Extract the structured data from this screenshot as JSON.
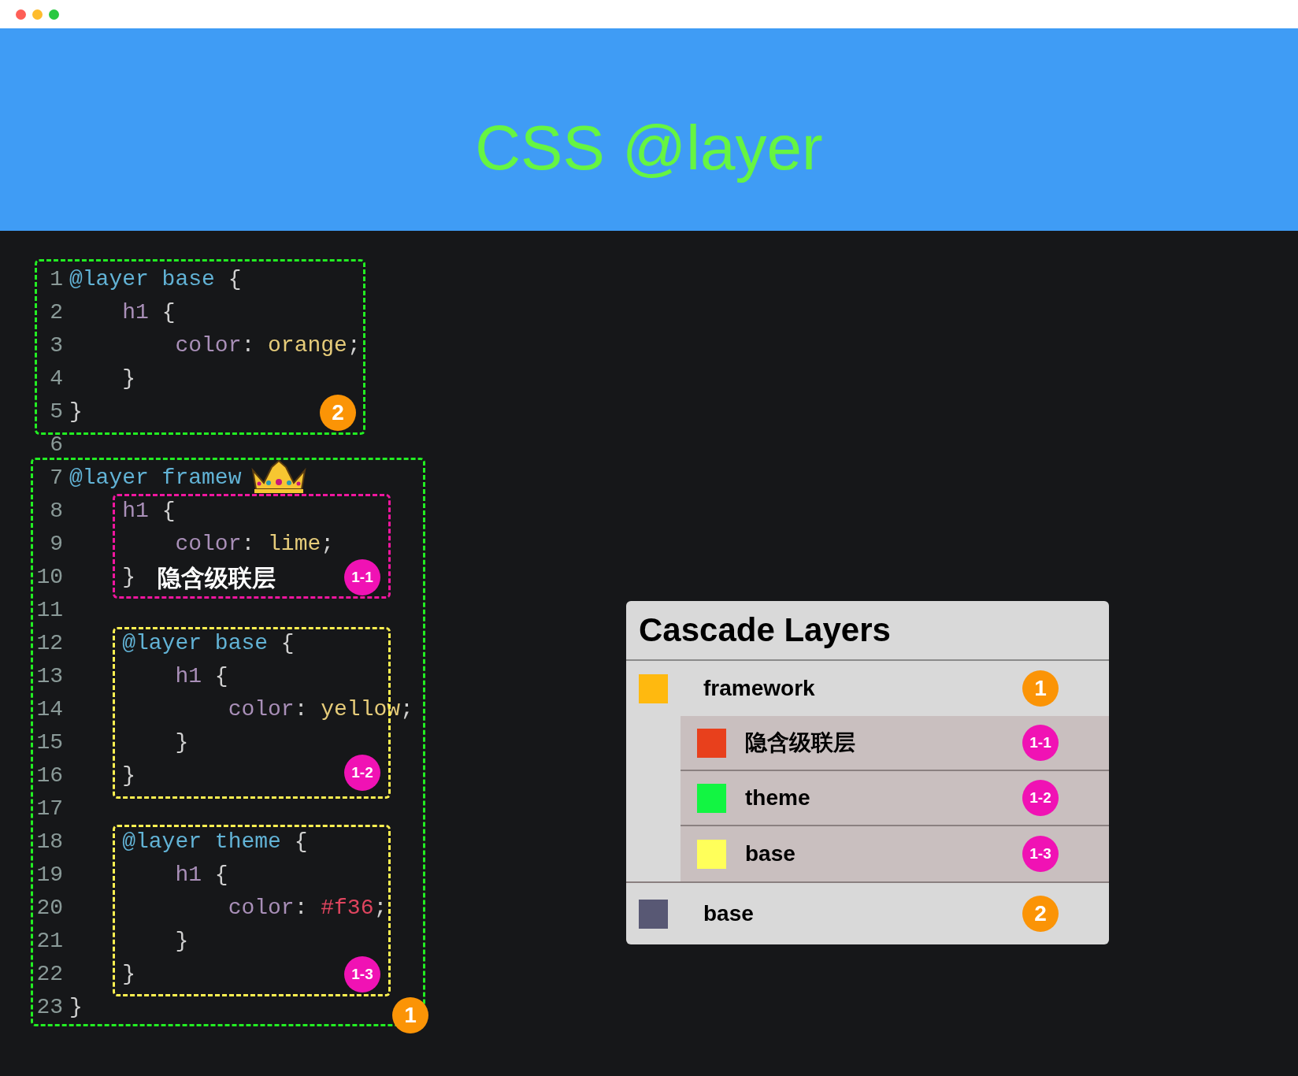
{
  "header": {
    "title": "CSS @layer"
  },
  "code": {
    "lines": [
      {
        "number": "1",
        "tokens": [
          {
            "kind": "keyword",
            "text": "@layer base"
          },
          {
            "kind": "punct",
            "text": " {"
          }
        ]
      },
      {
        "number": "2",
        "tokens": [
          {
            "kind": "selector",
            "text": "    h1"
          },
          {
            "kind": "punct",
            "text": " {"
          }
        ]
      },
      {
        "number": "3",
        "tokens": [
          {
            "kind": "property",
            "text": "        color"
          },
          {
            "kind": "punct",
            "text": ": "
          },
          {
            "kind": "value",
            "text": "orange"
          },
          {
            "kind": "punct",
            "text": ";"
          }
        ]
      },
      {
        "number": "4",
        "tokens": [
          {
            "kind": "punct",
            "text": "    }"
          }
        ]
      },
      {
        "number": "5",
        "tokens": [
          {
            "kind": "punct",
            "text": "}"
          }
        ]
      },
      {
        "number": "6"
      },
      {
        "number": "7",
        "tokens": [
          {
            "kind": "keyword",
            "text": "@layer framew"
          }
        ]
      },
      {
        "number": "8",
        "tokens": [
          {
            "kind": "selector",
            "text": "    h1"
          },
          {
            "kind": "punct",
            "text": " {"
          }
        ]
      },
      {
        "number": "9",
        "tokens": [
          {
            "kind": "property",
            "text": "        color"
          },
          {
            "kind": "punct",
            "text": ": "
          },
          {
            "kind": "value",
            "text": "lime"
          },
          {
            "kind": "punct",
            "text": ";"
          }
        ]
      },
      {
        "number": "10",
        "tokens": [
          {
            "kind": "punct",
            "text": "    }"
          }
        ],
        "note": "隐含级联层"
      },
      {
        "number": "11"
      },
      {
        "number": "12",
        "tokens": [
          {
            "kind": "keyword",
            "text": "    @layer base"
          },
          {
            "kind": "punct",
            "text": " {"
          }
        ]
      },
      {
        "number": "13",
        "tokens": [
          {
            "kind": "selector",
            "text": "        h1"
          },
          {
            "kind": "punct",
            "text": " {"
          }
        ]
      },
      {
        "number": "14",
        "tokens": [
          {
            "kind": "property",
            "text": "            color"
          },
          {
            "kind": "punct",
            "text": ": "
          },
          {
            "kind": "value",
            "text": "yellow"
          },
          {
            "kind": "punct",
            "text": ";"
          }
        ]
      },
      {
        "number": "15",
        "tokens": [
          {
            "kind": "punct",
            "text": "        }"
          }
        ]
      },
      {
        "number": "16",
        "tokens": [
          {
            "kind": "punct",
            "text": "    }"
          }
        ]
      },
      {
        "number": "17"
      },
      {
        "number": "18",
        "tokens": [
          {
            "kind": "keyword",
            "text": "    @layer theme"
          },
          {
            "kind": "punct",
            "text": " {"
          }
        ]
      },
      {
        "number": "19",
        "tokens": [
          {
            "kind": "selector",
            "text": "        h1"
          },
          {
            "kind": "punct",
            "text": " {"
          }
        ]
      },
      {
        "number": "20",
        "tokens": [
          {
            "kind": "property",
            "text": "            color"
          },
          {
            "kind": "punct",
            "text": ": "
          },
          {
            "kind": "hex",
            "text": "#f36"
          },
          {
            "kind": "punct",
            "text": ";"
          }
        ]
      },
      {
        "number": "21",
        "tokens": [
          {
            "kind": "punct",
            "text": "        }"
          }
        ]
      },
      {
        "number": "22",
        "tokens": [
          {
            "kind": "punct",
            "text": "    }"
          }
        ]
      },
      {
        "number": "23",
        "tokens": [
          {
            "kind": "punct",
            "text": "}"
          }
        ]
      }
    ],
    "blocks": [
      {
        "kind": "layer",
        "badge": "2"
      },
      {
        "kind": "implicit",
        "badge": "1-1"
      },
      {
        "kind": "nested",
        "badge": "1-2"
      },
      {
        "kind": "nested",
        "badge": "1-3"
      },
      {
        "kind": "layer",
        "badge": "1"
      }
    ]
  },
  "panel": {
    "title": "Cascade Layers",
    "layers": [
      {
        "name": "framework",
        "color": "#ffb90f",
        "badge": "1",
        "children": [
          {
            "name": "隐含级联层",
            "color": "#e8401c",
            "badge": "1-1"
          },
          {
            "name": "theme",
            "color": "#12f542",
            "badge": "1-2"
          },
          {
            "name": "base",
            "color": "#ffff5a",
            "badge": "1-3"
          }
        ]
      },
      {
        "name": "base",
        "color": "#585874",
        "badge": "2"
      }
    ]
  }
}
